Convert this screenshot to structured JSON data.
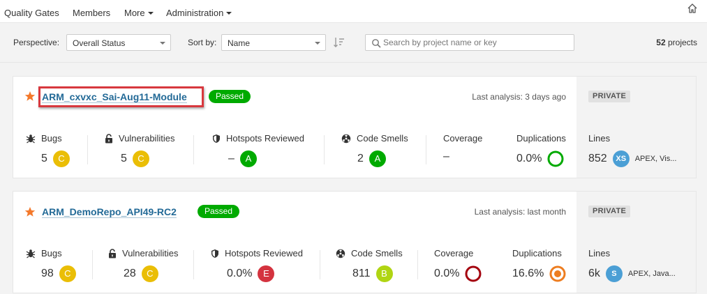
{
  "nav": {
    "items": [
      "Quality Gates",
      "Members",
      "More",
      "Administration"
    ]
  },
  "filters": {
    "perspective_label": "Perspective:",
    "perspective_value": "Overall Status",
    "sort_label": "Sort by:",
    "sort_value": "Name",
    "search_placeholder": "Search by project name or key",
    "count_number": "52",
    "count_suffix": " projects"
  },
  "projects": [
    {
      "name": "ARM_cxvxc_Sai-Aug11-Module",
      "quality_gate": "Passed",
      "last_analysis": "Last analysis: 3 days ago",
      "visibility": "PRIVATE",
      "bugs": {
        "label": "Bugs",
        "value": "5",
        "rating": "C"
      },
      "vulnerabilities": {
        "label": "Vulnerabilities",
        "value": "5",
        "rating": "C"
      },
      "hotspots": {
        "label": "Hotspots Reviewed",
        "value": "–",
        "rating": "A"
      },
      "code_smells": {
        "label": "Code Smells",
        "value": "2",
        "rating": "A"
      },
      "coverage": {
        "label": "Coverage",
        "value": "–"
      },
      "duplications": {
        "label": "Duplications",
        "value": "0.0%",
        "ring_color": "#00aa00"
      },
      "lines": {
        "label": "Lines",
        "value": "852",
        "size": "XS",
        "languages": "APEX, Vis..."
      }
    },
    {
      "name": "ARM_DemoRepo_API49-RC2",
      "quality_gate": "Passed",
      "last_analysis": "Last analysis: last month",
      "visibility": "PRIVATE",
      "bugs": {
        "label": "Bugs",
        "value": "98",
        "rating": "C"
      },
      "vulnerabilities": {
        "label": "Vulnerabilities",
        "value": "28",
        "rating": "C"
      },
      "hotspots": {
        "label": "Hotspots Reviewed",
        "value": "0.0%",
        "rating": "E"
      },
      "code_smells": {
        "label": "Code Smells",
        "value": "811",
        "rating": "B"
      },
      "coverage": {
        "label": "Coverage",
        "value": "0.0%",
        "ring_color": "#a4030f"
      },
      "duplications": {
        "label": "Duplications",
        "value": "16.6%",
        "ring_color": "#ed7d20"
      },
      "lines": {
        "label": "Lines",
        "value": "6k",
        "size": "S",
        "languages": "APEX, Java..."
      }
    }
  ],
  "colors": {
    "passed": "#00aa00",
    "link": "#236a97",
    "star": "#f4792b",
    "highlight": "#d8383e"
  }
}
